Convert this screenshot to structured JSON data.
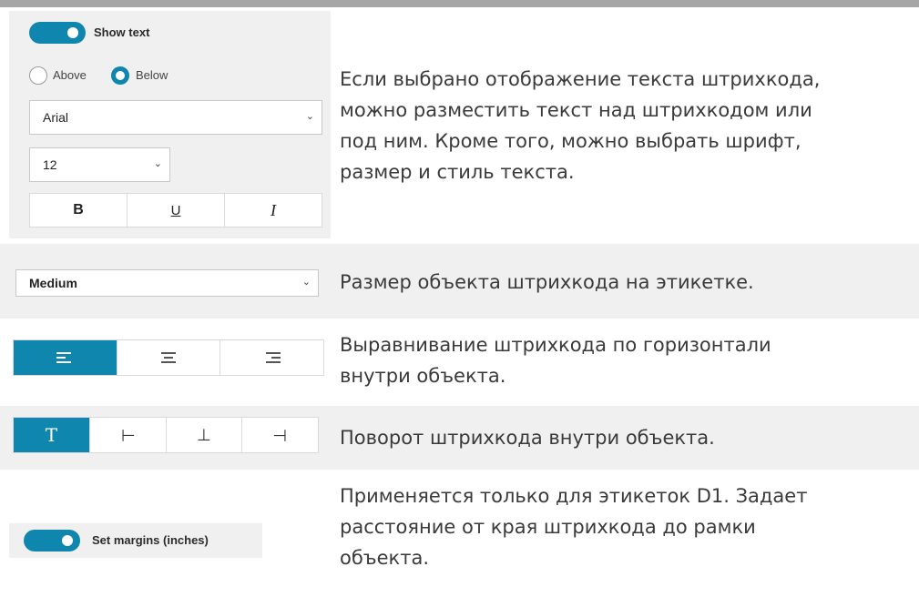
{
  "text_settings": {
    "show_text_label": "Show text",
    "position_options": [
      {
        "label": "Above",
        "selected": false
      },
      {
        "label": "Below",
        "selected": true
      }
    ],
    "font_value": "Arial",
    "size_value": "12",
    "style_buttons": [
      {
        "label": "B",
        "icon": "bold-icon"
      },
      {
        "label": "U",
        "icon": "underline-icon"
      },
      {
        "label": "I",
        "icon": "italic-icon"
      }
    ],
    "description": [
      "Если выбрано отображение текста штрихкода,",
      "можно разместить текст над штрихкодом или",
      "под ним. Кроме того, можно выбрать шрифт,",
      "размер и стиль текста."
    ]
  },
  "size_setting": {
    "value": "Medium",
    "description": "Размер объекта штрихкода на этикетке."
  },
  "alignment_setting": {
    "options": [
      "align-left-icon",
      "align-center-icon",
      "align-right-icon"
    ],
    "selected_index": 0,
    "description": [
      "Выравнивание штрихкода по горизонтали",
      "внутри объекта."
    ]
  },
  "rotation_setting": {
    "options": [
      "rotate-0-icon",
      "rotate-90-icon",
      "rotate-180-icon",
      "rotate-270-icon"
    ],
    "selected_index": 0,
    "description": "Поворот штрихкода внутри объекта."
  },
  "margins_setting": {
    "label": "Set margins (inches)",
    "description": [
      "Применяется только для этикеток D1. Задает",
      "расстояние от края штрихкода до рамки",
      "объекта."
    ]
  },
  "colors": {
    "accent": "#0e86ad",
    "band": "#f0f0f0"
  }
}
